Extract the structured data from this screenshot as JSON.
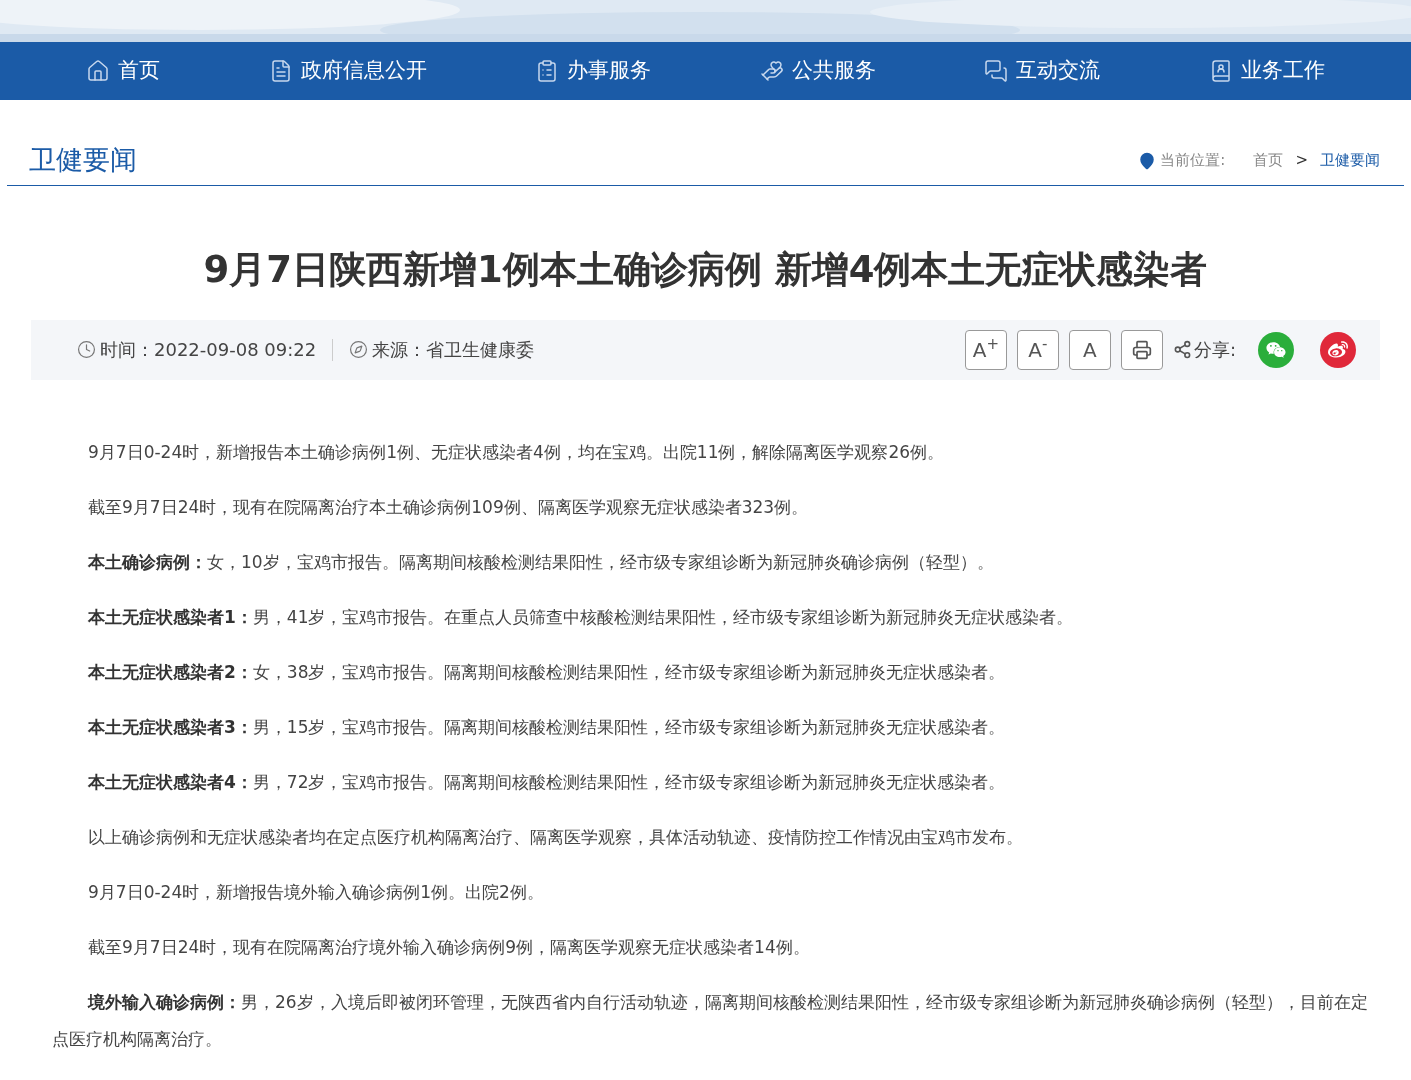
{
  "nav": [
    {
      "kind": "home",
      "label": "首页"
    },
    {
      "kind": "info",
      "label": "政府信息公开"
    },
    {
      "kind": "service",
      "label": "办事服务"
    },
    {
      "kind": "public",
      "label": "公共服务"
    },
    {
      "kind": "interact",
      "label": "互动交流"
    },
    {
      "kind": "work",
      "label": "业务工作"
    }
  ],
  "section": {
    "title": "卫健要闻",
    "breadcrumb_label": "当前位置:",
    "breadcrumb": [
      "首页",
      "卫健要闻"
    ],
    "separator": ">"
  },
  "article": {
    "title": "9月7日陕西新增1例本土确诊病例 新增4例本土无症状感染者",
    "time": "时间：2022-09-08 09:22",
    "source": "来源：省卫生健康委",
    "font_buttons": [
      "A$^{+}$",
      "A$^{-}$",
      "A"
    ],
    "share_label": "分享:",
    "paragraphs": [
      "9月7日0-24时，新增报告本土确诊病例1例、无症状感染者4例，均在宝鸡。出院11例，解除隔离医学观察26例。",
      "截至9月7日24时，现有在院隔离治疗本土确诊病例109例、隔离医学观察无症状感染者323例。",
      "**本土确诊病例：**女，10岁，宝鸡市报告。隔离期间核酸检测结果阳性，经市级专家组诊断为新冠肺炎确诊病例（轻型）。",
      "**本土无症状感染者1：**男，41岁，宝鸡市报告。在重点人员筛查中核酸检测结果阳性，经市级专家组诊断为新冠肺炎无症状感染者。",
      "**本土无症状感染者2：**女，38岁，宝鸡市报告。隔离期间核酸检测结果阳性，经市级专家组诊断为新冠肺炎无症状感染者。",
      "**本土无症状感染者3：**男，15岁，宝鸡市报告。隔离期间核酸检测结果阳性，经市级专家组诊断为新冠肺炎无症状感染者。",
      "**本土无症状感染者4：**男，72岁，宝鸡市报告。隔离期间核酸检测结果阳性，经市级专家组诊断为新冠肺炎无症状感染者。",
      "以上确诊病例和无症状感染者均在定点医疗机构隔离治疗、隔离医学观察，具体活动轨迹、疫情防控工作情况由宝鸡市发布。",
      "9月7日0-24时，新增报告境外输入确诊病例1例。出院2例。",
      "截至9月7日24时，现有在院隔离治疗境外输入确诊病例9例，隔离医学观察无症状感染者14例。",
      "**境外输入确诊病例：**男，26岁，入境后即被闭环管理，无陕西省内自行活动轨迹，隔离期间核酸检测结果阳性，经市级专家组诊断为新冠肺炎确诊病例（轻型），目前在定点医疗机构隔离治疗。"
    ]
  }
}
